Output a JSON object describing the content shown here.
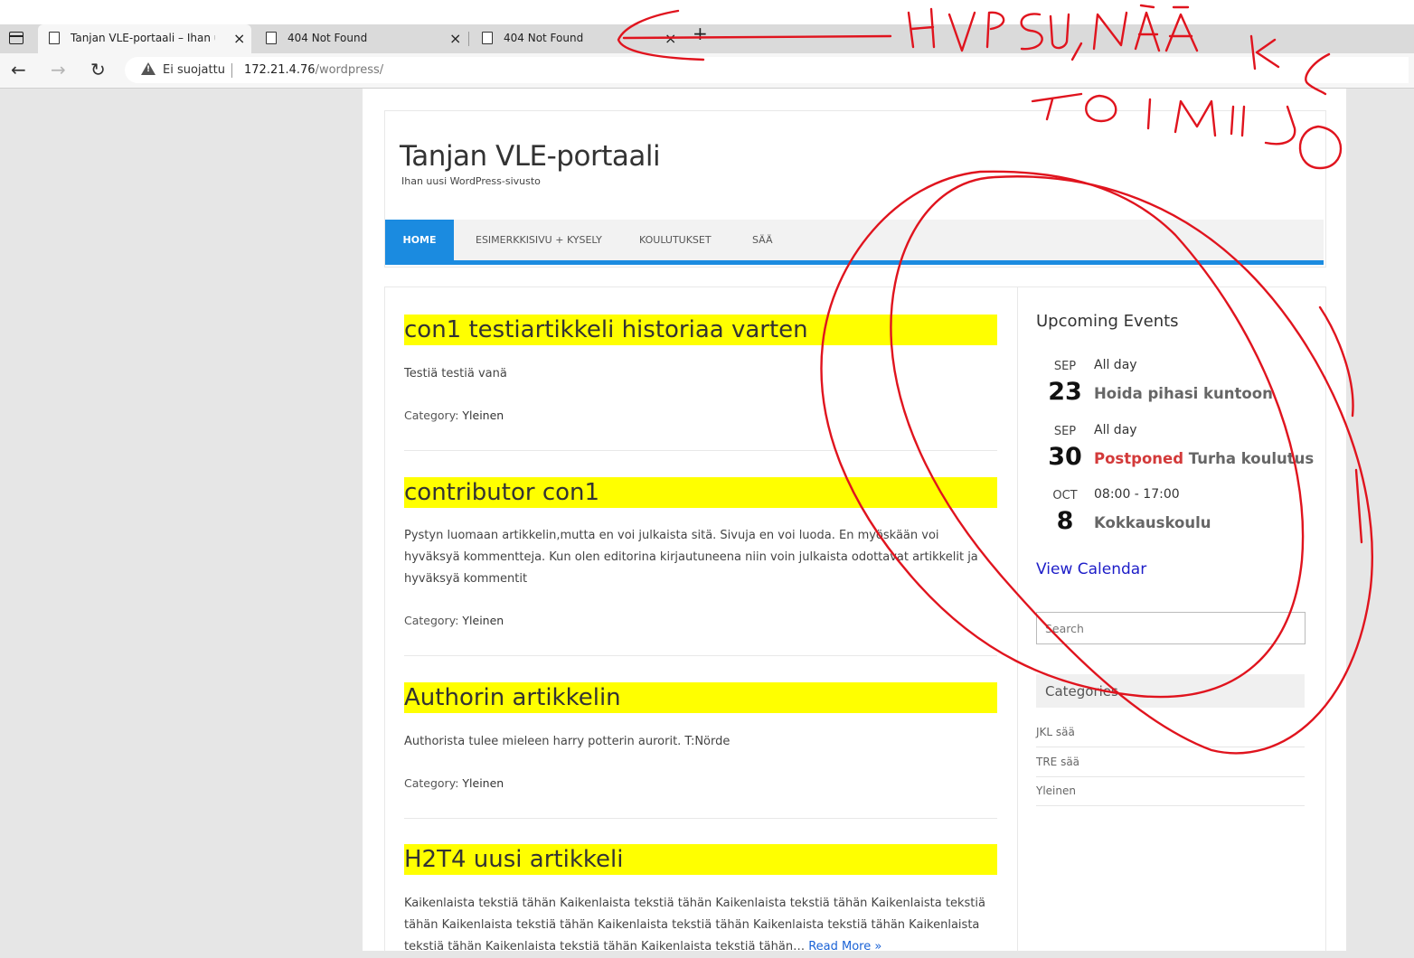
{
  "browser": {
    "tabs": [
      {
        "title": "Tanjan VLE-portaali – Ihan uusi W",
        "active": true
      },
      {
        "title": "404 Not Found",
        "active": false
      },
      {
        "title": "404 Not Found",
        "active": false
      }
    ],
    "security_label": "Ei suojattu",
    "url_host": "172.21.4.76",
    "url_path": "/wordpress/",
    "close_glyph": "×",
    "new_tab_glyph": "+",
    "back_glyph": "←",
    "forward_glyph": "→",
    "reload_glyph": "↻"
  },
  "site": {
    "title": "Tanjan VLE-portaali",
    "description": "Ihan uusi WordPress-sivusto"
  },
  "nav": {
    "items": [
      {
        "label": "HOME",
        "active": true
      },
      {
        "label": "ESIMERKKISIVU + KYSELY",
        "active": false
      },
      {
        "label": "KOULUTUKSET",
        "active": false
      },
      {
        "label": "SÄÄ",
        "active": false
      }
    ]
  },
  "posts": [
    {
      "title": "con1 testiartikkeli historiaa varten",
      "excerpt": "Testiä testiä vanä",
      "category_label": "Category:",
      "category": "Yleinen"
    },
    {
      "title": "contributor con1",
      "excerpt": "Pystyn luomaan artikkelin,mutta en voi julkaista sitä. Sivuja en voi luoda. En myöskään voi hyväksyä kommentteja. Kun olen editorina kirjautuneena niin voin julkaista odottavat artikkelit ja hyväksyä kommentit",
      "category_label": "Category:",
      "category": "Yleinen"
    },
    {
      "title": "Authorin artikkelin",
      "excerpt": "Authorista tulee mieleen harry potterin aurorit. T:Nörde",
      "category_label": "Category:",
      "category": "Yleinen"
    },
    {
      "title": "H2T4 uusi artikkeli",
      "excerpt": "Kaikenlaista tekstiä tähän Kaikenlaista tekstiä tähän Kaikenlaista tekstiä tähän Kaikenlaista tekstiä tähän Kaikenlaista tekstiä tähän Kaikenlaista tekstiä tähän Kaikenlaista tekstiä tähän Kaikenlaista tekstiä tähän Kaikenlaista tekstiä tähän Kaikenlaista tekstiä tähän…",
      "read_more": "Read More »"
    }
  ],
  "sidebar": {
    "events_title": "Upcoming Events",
    "events": [
      {
        "month": "SEP",
        "day": "23",
        "time": "All day",
        "status": "",
        "name": "Hoida pihasi kuntoon"
      },
      {
        "month": "SEP",
        "day": "30",
        "time": "All day",
        "status": "Postponed",
        "name": "Turha koulutus"
      },
      {
        "month": "OCT",
        "day": "8",
        "time": "08:00 - 17:00",
        "status": "",
        "name": "Kokkauskoulu"
      }
    ],
    "view_calendar": "View Calendar",
    "search_placeholder": "Search",
    "categories_title": "Categories",
    "categories": [
      "JKL sää",
      "TRE sää",
      "Yleinen"
    ]
  },
  "colors": {
    "accent": "#1b8be0",
    "highlight": "#ffff00",
    "postponed": "#d33a3a",
    "annotation": "#e0141e"
  },
  "annotation_icon": "handwritten-red-pen-annotation"
}
